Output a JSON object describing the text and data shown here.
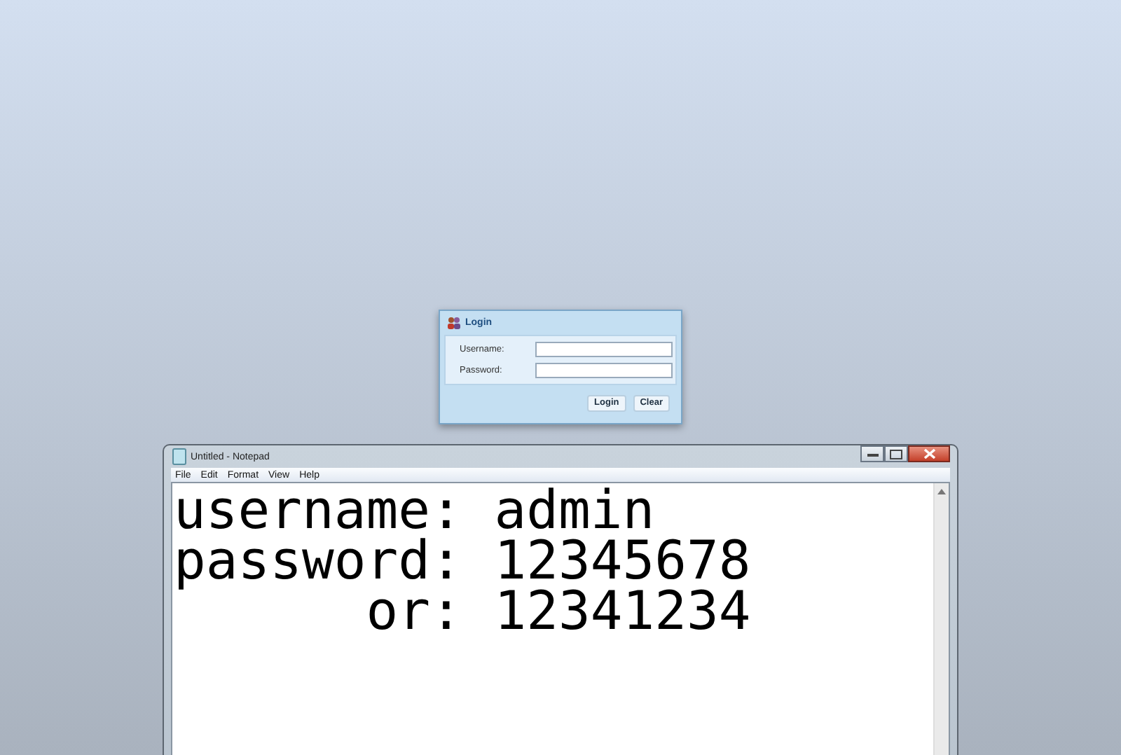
{
  "login_dialog": {
    "title": "Login",
    "fields": [
      {
        "label": "Username:"
      },
      {
        "label": "Password:"
      }
    ],
    "buttons": [
      "Login",
      "Clear"
    ]
  },
  "notepad": {
    "title": "Untitled - Notepad",
    "menu": [
      "File",
      "Edit",
      "Format",
      "View",
      "Help"
    ],
    "lines": [
      "username: admin",
      "password: 12345678",
      "      or: 12341234"
    ]
  }
}
